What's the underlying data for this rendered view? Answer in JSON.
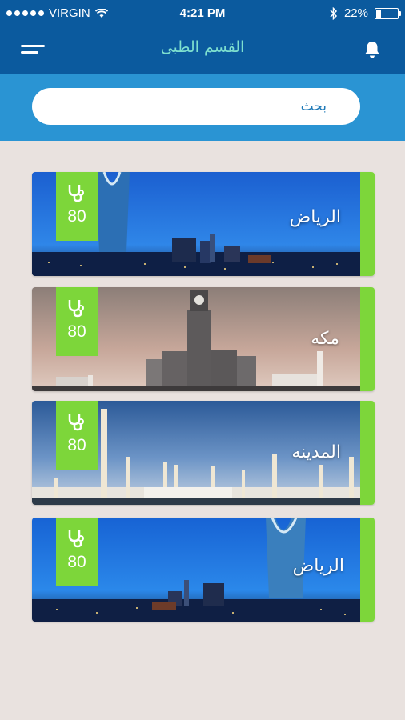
{
  "status_bar": {
    "carrier": "VIRGIN",
    "time": "4:21 PM",
    "battery": "22%",
    "battery_level": 0.22
  },
  "header": {
    "title": "القسم الطبى",
    "menu_icon": "hamburger-icon",
    "bell_icon": "bell-icon"
  },
  "search": {
    "placeholder": "بحث"
  },
  "cards": [
    {
      "city": "الرياض",
      "count": "80",
      "icon": "stethoscope-icon"
    },
    {
      "city": "مكه",
      "count": "80",
      "icon": "stethoscope-icon"
    },
    {
      "city": "المدينه",
      "count": "80",
      "icon": "stethoscope-icon"
    },
    {
      "city": "الرياض",
      "count": "80",
      "icon": "stethoscope-icon"
    }
  ],
  "colors": {
    "primary": "#0b5a9e",
    "search_band": "#2a94d3",
    "accent_green": "#7dd63a",
    "title_teal": "#7ee0cf",
    "background": "#e9e2df"
  }
}
